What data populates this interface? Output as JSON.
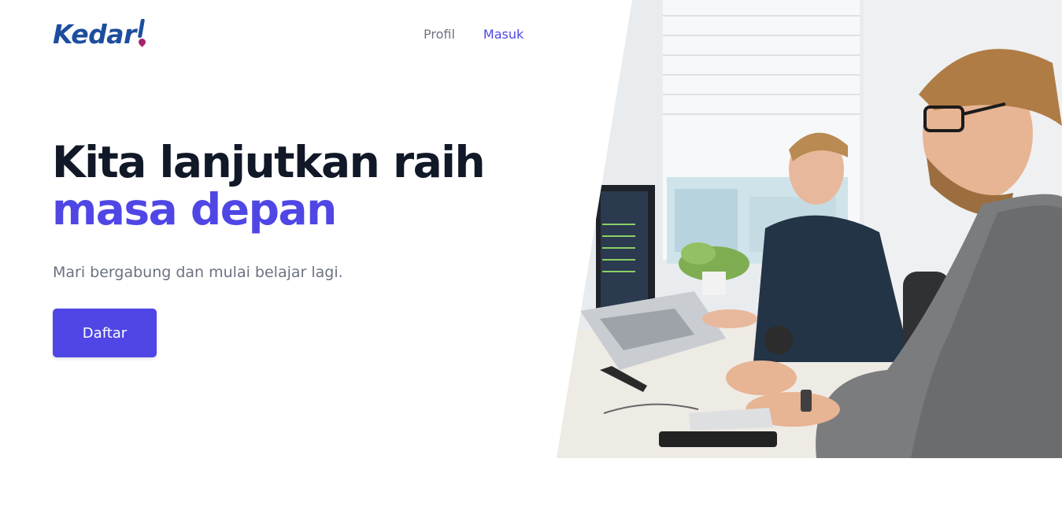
{
  "brand": {
    "name": "Kedar"
  },
  "nav": {
    "items": [
      {
        "label": "Profil",
        "active": false
      },
      {
        "label": "Masuk",
        "active": true
      }
    ]
  },
  "hero": {
    "title_line1": "Kita lanjutkan raih",
    "title_line2": "masa depan",
    "subtitle": "Mari bergabung dan mulai belajar lagi.",
    "cta_label": "Daftar"
  },
  "colors": {
    "primary": "#4f46e5",
    "heading": "#111827",
    "muted": "#6b7280",
    "logo": "#1d4e9e",
    "logo_pin": "#a3246a"
  }
}
